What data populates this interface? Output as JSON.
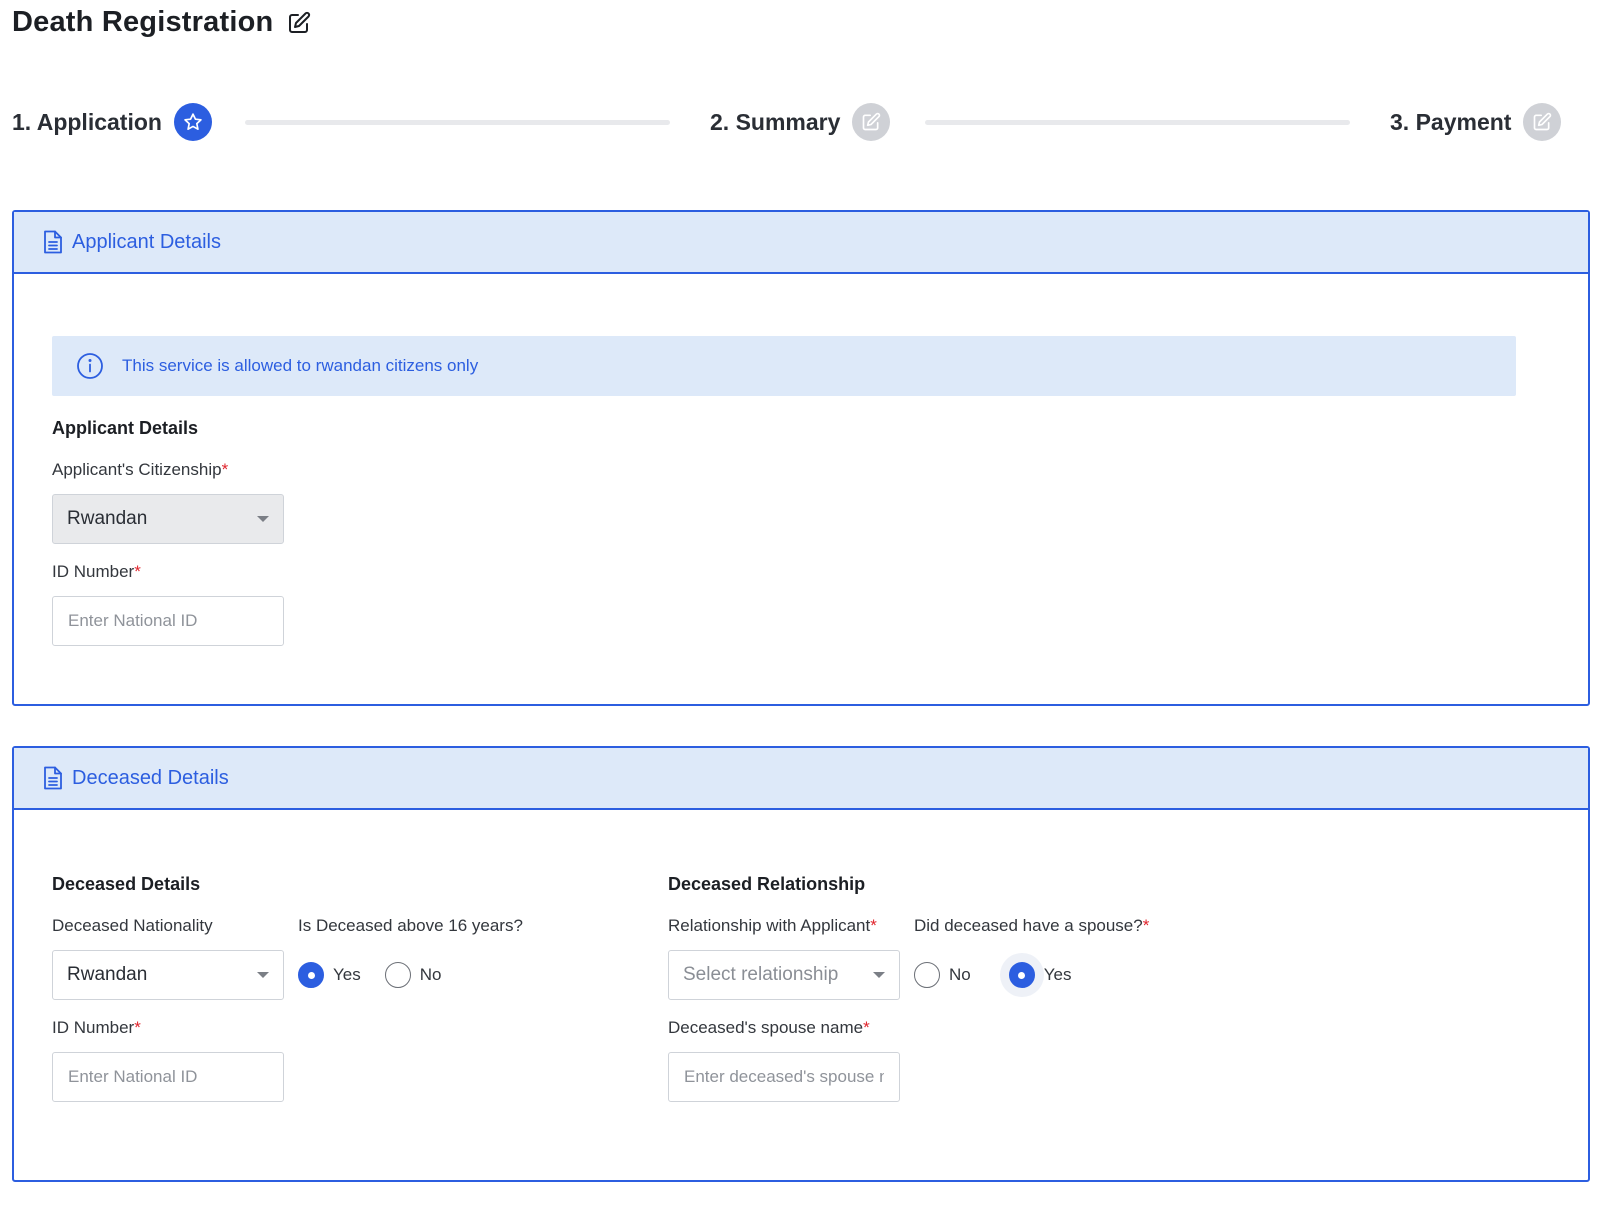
{
  "page": {
    "title": "Death Registration",
    "edit_icon": "edit-icon"
  },
  "stepper": {
    "steps": [
      {
        "label": "1. Application",
        "state": "active",
        "icon": "star-icon"
      },
      {
        "label": "2. Summary",
        "state": "inactive",
        "icon": "edit-icon"
      },
      {
        "label": "3. Payment",
        "state": "inactive",
        "icon": "edit-icon"
      }
    ]
  },
  "applicant_panel": {
    "title": "Applicant Details",
    "icon": "document-icon",
    "alert": {
      "text": "This service is allowed to rwandan citizens only",
      "icon": "info-icon"
    },
    "section_title": "Applicant Details",
    "citizenship": {
      "label": "Applicant's Citizenship",
      "required_mark": "*",
      "value": "Rwandan"
    },
    "id_number": {
      "label": "ID Number",
      "required_mark": "*",
      "placeholder": "Enter National ID"
    }
  },
  "deceased_panel": {
    "title": "Deceased Details",
    "icon": "document-icon",
    "details_section_title": "Deceased Details",
    "nationality": {
      "label": "Deceased Nationality",
      "value": "Rwandan"
    },
    "above16": {
      "label": "Is Deceased above 16 years?",
      "options": [
        "Yes",
        "No"
      ],
      "selected": "Yes"
    },
    "id_number": {
      "label": "ID Number",
      "required_mark": "*",
      "placeholder": "Enter National ID"
    },
    "relationship_section_title": "Deceased Relationship",
    "relationship": {
      "label": "Relationship with Applicant",
      "required_mark": "*",
      "placeholder": "Select relationship"
    },
    "spouse": {
      "label": "Did deceased have a spouse?",
      "required_mark": "*",
      "options": [
        "No",
        "Yes"
      ],
      "selected": "Yes"
    },
    "spouse_name": {
      "label": "Deceased's spouse name",
      "required_mark": "*",
      "placeholder": "Enter deceased's spouse name"
    }
  },
  "colors": {
    "primary": "#2c5ee0",
    "header_bg": "#dde9f9",
    "required": "#e0242c",
    "inactive_step": "#cfd1d6"
  }
}
